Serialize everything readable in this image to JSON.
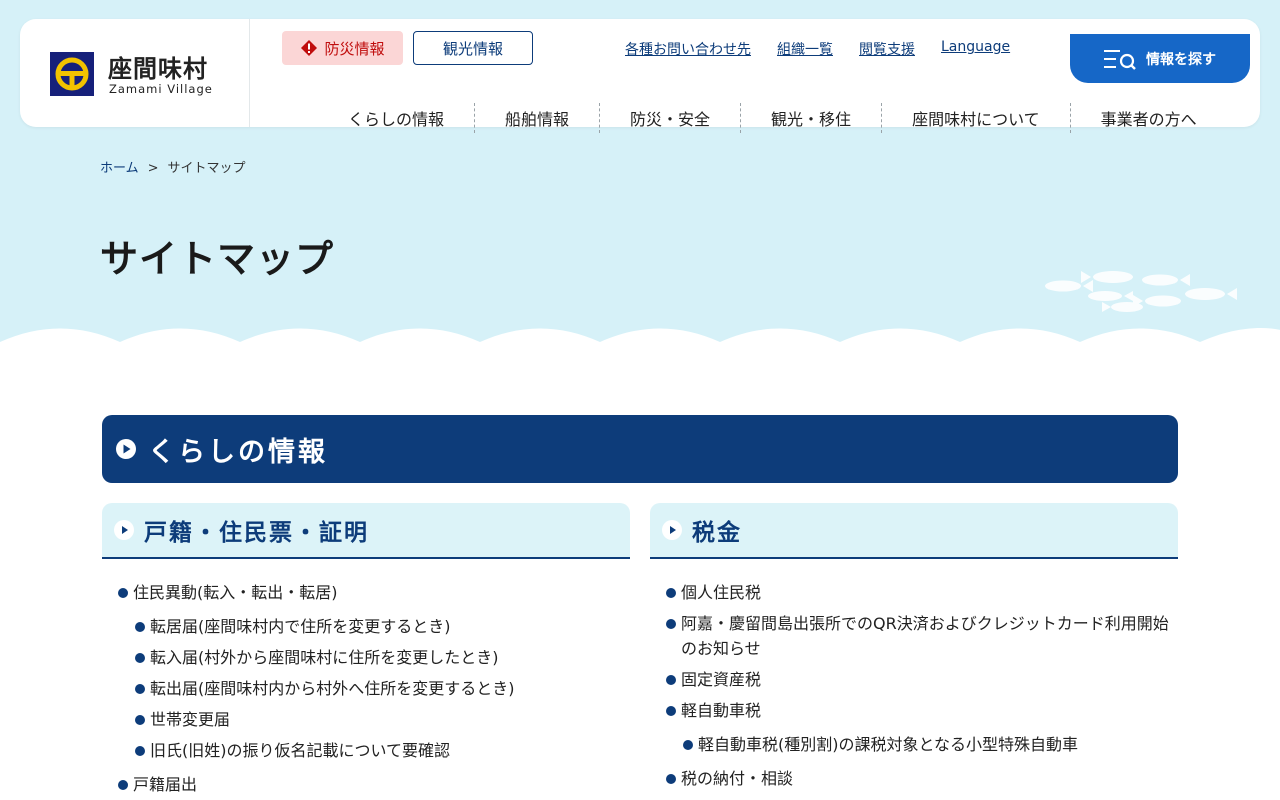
{
  "header": {
    "logo_ja": "座間味村",
    "logo_en": "Zamami Village",
    "bousai_label": "防災情報",
    "kanko_label": "観光情報",
    "util_links": [
      "各種お問い合わせ先",
      "組織一覧",
      "閲覧支援",
      "Language"
    ],
    "search_label": "情報を探す",
    "gnav": [
      "くらしの情報",
      "船舶情報",
      "防災・安全",
      "観光・移住",
      "座間味村について",
      "事業者の方へ"
    ]
  },
  "breadcrumb": {
    "home": "ホーム",
    "sep": ">",
    "current": "サイトマップ"
  },
  "page_title": "サイトマップ",
  "section": {
    "title": "くらしの情報",
    "left": {
      "title": "戸籍・住民票・証明",
      "items": [
        {
          "label": "住民異動(転入・転出・転居)",
          "children": [
            "転居届(座間味村内で住所を変更するとき)",
            "転入届(村外から座間味村に住所を変更したとき)",
            "転出届(座間味村内から村外へ住所を変更するとき)",
            "世帯変更届",
            "旧氏(旧姓)の振り仮名記載について要確認"
          ]
        },
        {
          "label": "戸籍届出",
          "children": []
        }
      ]
    },
    "right": {
      "title": "税金",
      "items": [
        {
          "label": "個人住民税",
          "children": []
        },
        {
          "label": "阿嘉・慶留間島出張所でのQR決済およびクレジットカード利用開始のお知らせ",
          "children": []
        },
        {
          "label": "固定資産税",
          "children": []
        },
        {
          "label": "軽自動車税",
          "children": [
            "軽自動車税(種別割)の課税対象となる小型特殊自動車"
          ]
        },
        {
          "label": "税の納付・相談",
          "children": []
        }
      ]
    }
  },
  "colors": {
    "navy": "#0d3c7a",
    "sky": "#d6f1f8",
    "alert_red": "#c00d0d",
    "search_blue": "#1667c7"
  }
}
